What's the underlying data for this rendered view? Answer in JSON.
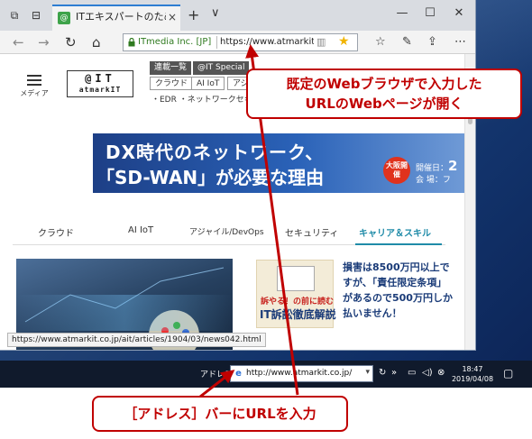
{
  "browser": {
    "tab_title": "ITエキスパートのための問題",
    "tab_close": "×",
    "new_tab": "+",
    "tab_list": "∨",
    "minimize": "—",
    "maximize": "☐",
    "close": "✕",
    "site_identity": "ITmedia Inc. [JP]",
    "url": "https://www.atmarkit.co",
    "status_url": "https://www.atmarkit.co.jp/ait/articles/1904/03/news042.html"
  },
  "page": {
    "menu_label": "メディア",
    "logo_top": "@IT",
    "logo_bottom": "atmarkIT",
    "pills": {
      "p1": "連載一覧",
      "p2": "@IT Special",
      "p3": "クラウド",
      "p4": "AI IoT",
      "p5": "アジャイ"
    },
    "topic_links": "・EDR  ・ネットワークセキュ",
    "banner": {
      "line1": "DX時代のネットワーク、",
      "line2": "「SD-WAN」が必要な理由",
      "badge": "大阪開催",
      "date_label1": "開催日：",
      "date_value": "2",
      "date_label2": "会 場：フ"
    },
    "categories": [
      "クラウド",
      "AI IoT",
      "アジャイル/DevOps",
      "セキュリティ",
      "キャリア＆スキル"
    ],
    "ad_small1": "訴やる！の前に読む",
    "ad_small2": "IT訴訟徹底解説",
    "ad_text": "損害は8500万円以上ですが、「責任限定条項」があるので500万円しか払いません！"
  },
  "taskbar": {
    "address_label": "アドレス",
    "address_url": "http://www.atmarkit.co.jp/",
    "clock_time": "18:47",
    "clock_date": "2019/04/08"
  },
  "callouts": {
    "top_line1": "既定のWebブラウザで入力した",
    "top_line2": "URLのWebページが開く",
    "bottom": "［アドレス］バーにURLを入力"
  },
  "colors": {
    "accent_red": "#c00000",
    "tab_accent": "#2d7dd2",
    "category_active": "#1f8ba8"
  }
}
